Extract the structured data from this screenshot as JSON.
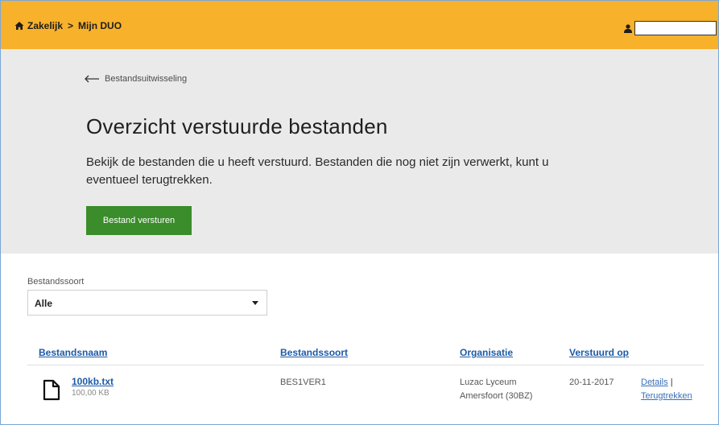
{
  "header": {
    "breadcrumb_home": "Zakelijk",
    "breadcrumb_separator": ">",
    "breadcrumb_current": "Mijn DUO",
    "home_icon": "home-icon",
    "user_icon": "user-icon"
  },
  "hero": {
    "back_link": "Bestandsuitwisseling",
    "title": "Overzicht verstuurde bestanden",
    "intro": "Bekijk de bestanden die u heeft verstuurd. Bestanden die nog niet zijn verwerkt, kunt u eventueel terugtrekken.",
    "send_button": "Bestand versturen"
  },
  "filter": {
    "label": "Bestandssoort",
    "selected": "Alle"
  },
  "table": {
    "headers": [
      "Bestandsnaam",
      "Bestandssoort",
      "Organisatie",
      "Verstuurd op"
    ],
    "rows": [
      {
        "name": "100kb.txt",
        "size": "100,00 KB",
        "type": "BES1VER1",
        "org_line1": "Luzac Lyceum",
        "org_line2": "Amersfoort (30BZ)",
        "date": "20-11-2017",
        "details": "Details",
        "pipe": "|",
        "withdraw": "Terugtrekken"
      }
    ]
  },
  "colors": {
    "header_bg": "#f7b12b",
    "hero_bg": "#eaeaea",
    "button_green": "#3a8d2a",
    "link_blue": "#1c5aa6"
  }
}
